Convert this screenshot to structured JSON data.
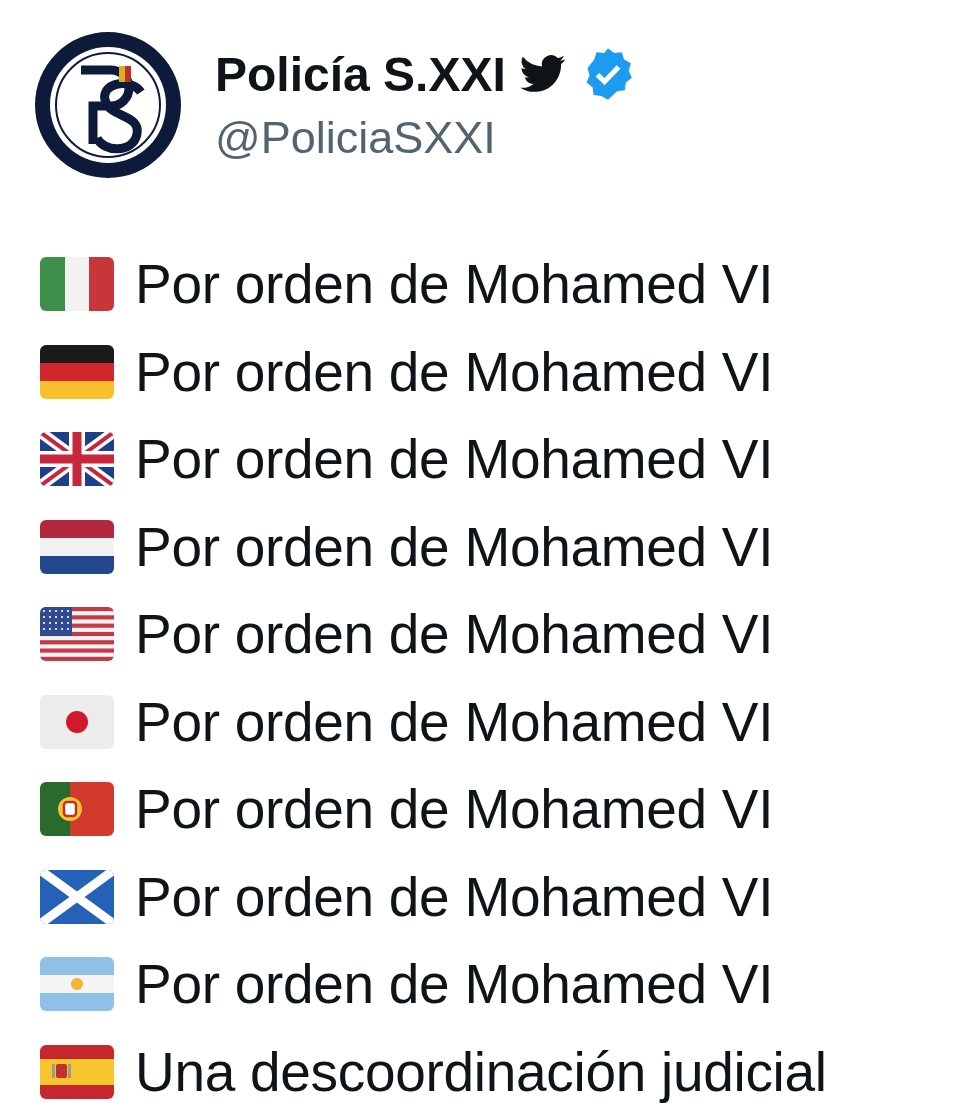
{
  "author": {
    "name": "Policía S.XXI",
    "handle": "@PoliciaSXXI",
    "verified": true
  },
  "lines": [
    {
      "kind": "italy",
      "text": "Por orden de Mohamed VI"
    },
    {
      "kind": "germany",
      "text": "Por orden de Mohamed VI"
    },
    {
      "kind": "uk",
      "text": "Por orden de Mohamed VI"
    },
    {
      "kind": "netherlands",
      "text": "Por orden de Mohamed VI"
    },
    {
      "kind": "usa",
      "text": "Por orden de Mohamed VI"
    },
    {
      "kind": "japan",
      "text": "Por orden de Mohamed VI"
    },
    {
      "kind": "portugal",
      "text": "Por orden de Mohamed VI"
    },
    {
      "kind": "scotland",
      "text": "Por orden de Mohamed VI"
    },
    {
      "kind": "argentina",
      "text": "Por orden de Mohamed VI"
    },
    {
      "kind": "spain",
      "text": "Una descoordinación judicial"
    }
  ]
}
